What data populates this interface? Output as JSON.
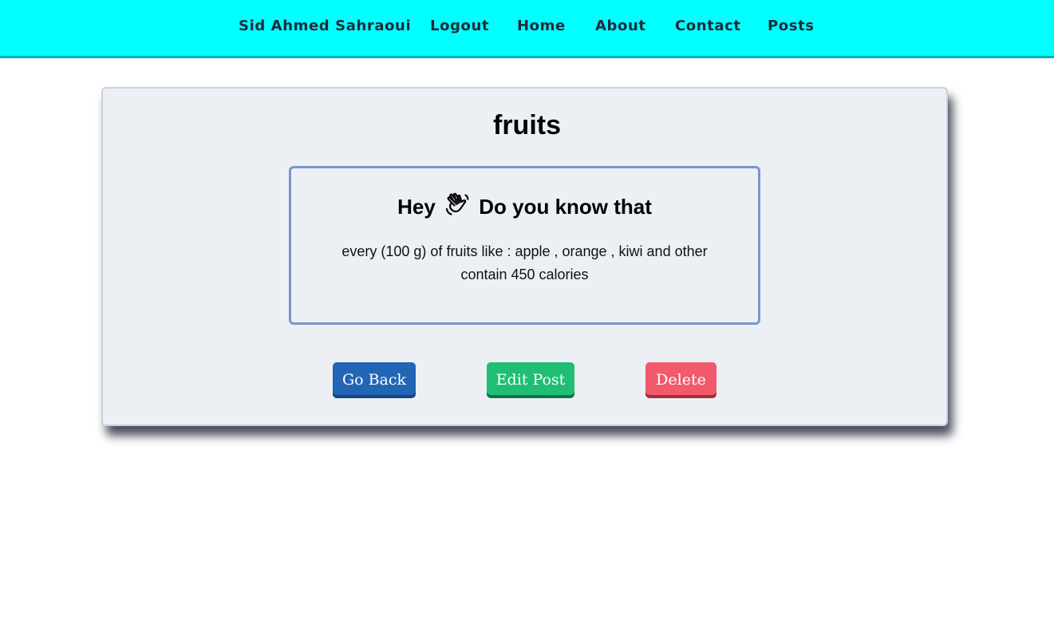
{
  "nav": {
    "user_name": "Sid Ahmed Sahraoui",
    "logout": "Logout",
    "home": "Home",
    "about": "About",
    "contact": "Contact",
    "posts": "Posts",
    "background_color": "#00ffff"
  },
  "post": {
    "title": "fruits",
    "heading_before": "Hey",
    "heading_icon": "waving-hand-icon",
    "heading_after": "Do you know that",
    "body": "every (100 g) of fruits like : apple , orange , kiwi and other contain 450 calories"
  },
  "actions": {
    "go_back": "Go Back",
    "edit_post": "Edit Post",
    "delete": "Delete",
    "colors": {
      "go_back": "#2265b5",
      "edit_post": "#1fbe74",
      "delete": "#f25a6b"
    }
  }
}
